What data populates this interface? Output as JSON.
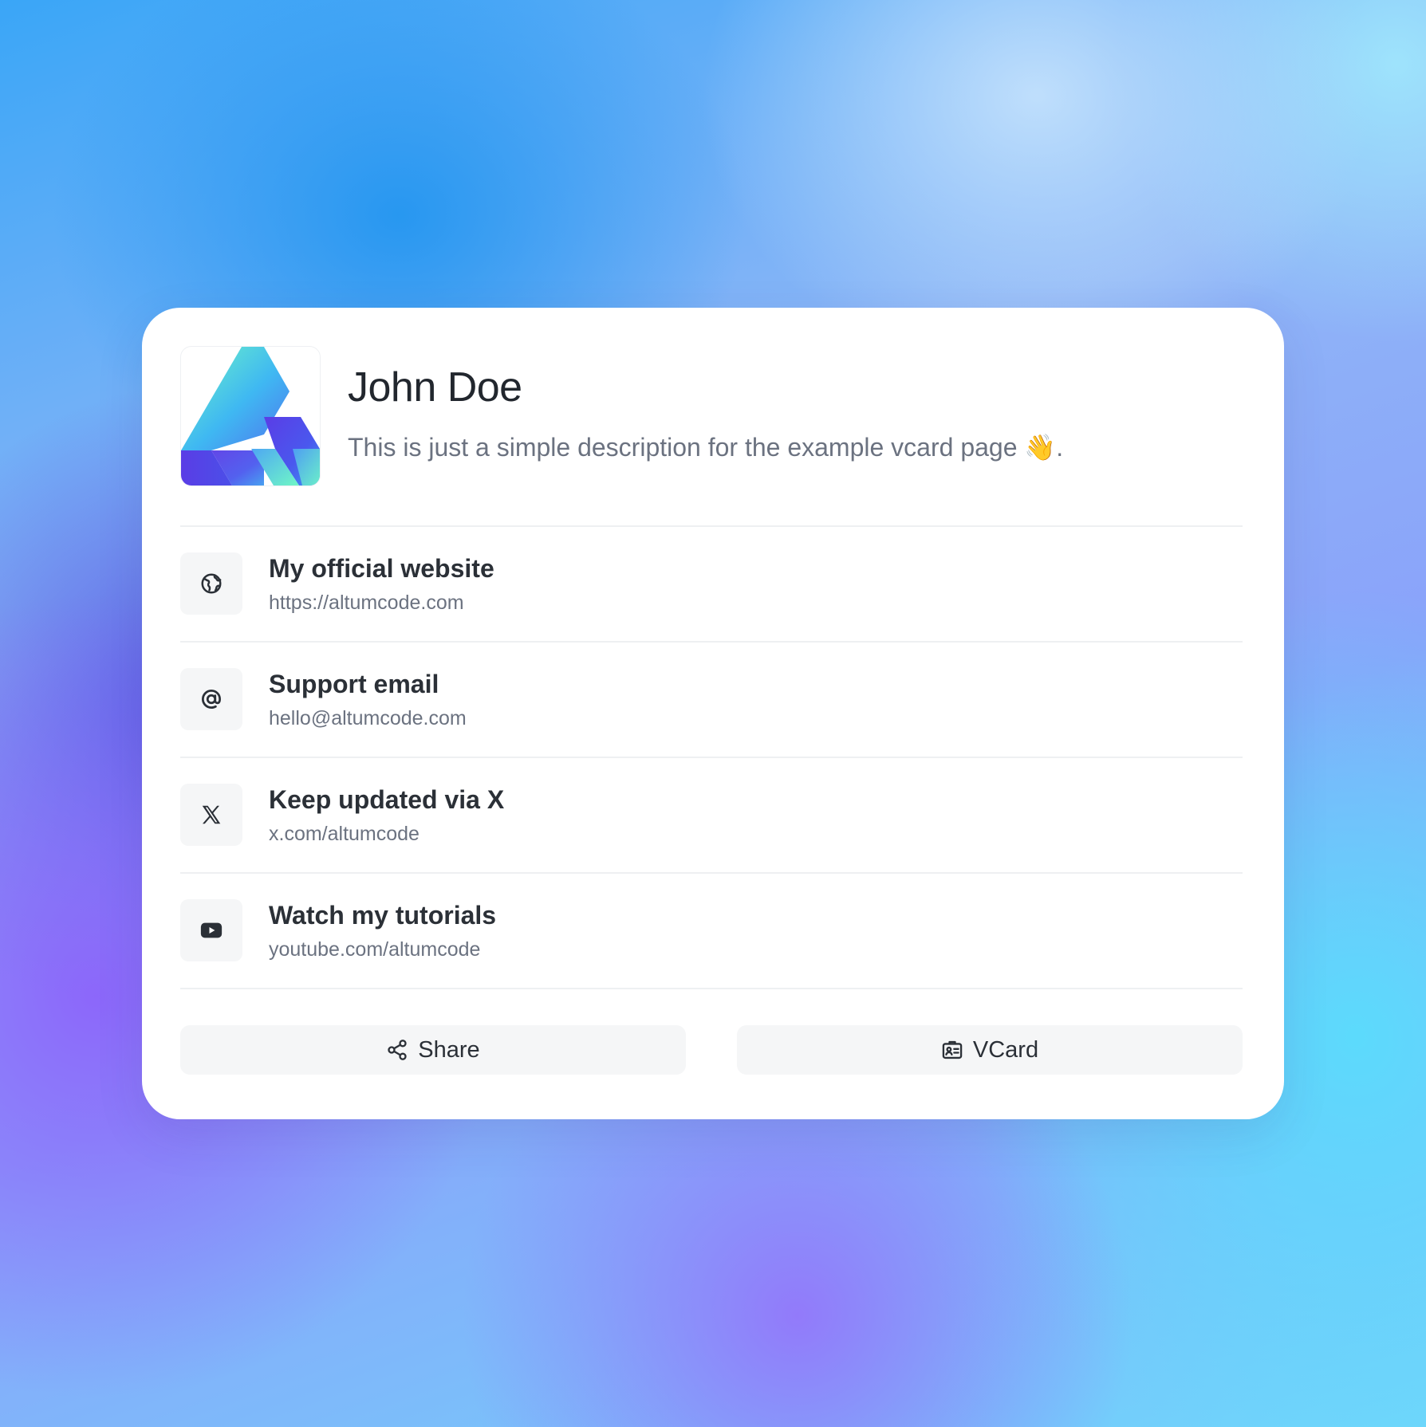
{
  "profile": {
    "name": "John Doe",
    "description": "This is just a simple description for the example vcard page 👋."
  },
  "links": [
    {
      "icon": "globe-icon",
      "title": "My official website",
      "url": "https://altumcode.com"
    },
    {
      "icon": "at-sign-icon",
      "title": "Support email",
      "url": "hello@altumcode.com"
    },
    {
      "icon": "x-logo-icon",
      "title": "Keep updated via X",
      "url": "x.com/altumcode"
    },
    {
      "icon": "youtube-icon",
      "title": "Watch my tutorials",
      "url": "youtube.com/altumcode"
    }
  ],
  "actions": {
    "share_label": "Share",
    "vcard_label": "VCard"
  },
  "colors": {
    "text_primary": "#2b3037",
    "text_secondary": "#6b7280",
    "card_bg": "#ffffff",
    "icon_box_bg": "#f5f6f7",
    "logo_teal": "#5ff0c8",
    "logo_indigo": "#5a3de6"
  }
}
